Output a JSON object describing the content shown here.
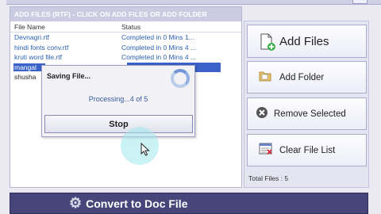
{
  "panel": {
    "header": "ADD FILES (RTF) - CLICK ON ADD FILES OR ADD FOLDER",
    "columns": {
      "file_name": "File Name",
      "status": "Status"
    },
    "rows": [
      {
        "name": "Devnagri.rtf",
        "status": "Completed in 0 Mins 1..."
      },
      {
        "name": "hindi fonts conv.rtf",
        "status": "Completed in 0 Mins 4 ..."
      },
      {
        "name": "kruti word file.rtf",
        "status": "Completed in 0 Mins 4 ..."
      },
      {
        "name": "mangal",
        "status": ""
      },
      {
        "name": "shusha",
        "status": ""
      }
    ]
  },
  "dialog": {
    "title": "Saving File...",
    "message": "Processing...4 of 5",
    "stop_label": "Stop"
  },
  "sidebar": {
    "add_files": "Add Files",
    "add_folder": "Add Folder",
    "remove_selected": "Remove Selected",
    "clear_file_list": "Clear File List",
    "total_files": "Total Files : 5"
  },
  "convert_label": "Convert to Doc File",
  "icons": {
    "add_files": "add-file-icon",
    "add_folder": "folder-icon",
    "remove": "remove-icon",
    "clear": "clear-list-icon",
    "convert": "gear-icon",
    "spinner": "spinner-icon",
    "cursor": "mouse-cursor-icon"
  },
  "colors": {
    "selection": "#3a62c8",
    "link_text": "#2a5fb0",
    "convert_bar": "#46467b",
    "header_bg": "#cbcce2"
  }
}
